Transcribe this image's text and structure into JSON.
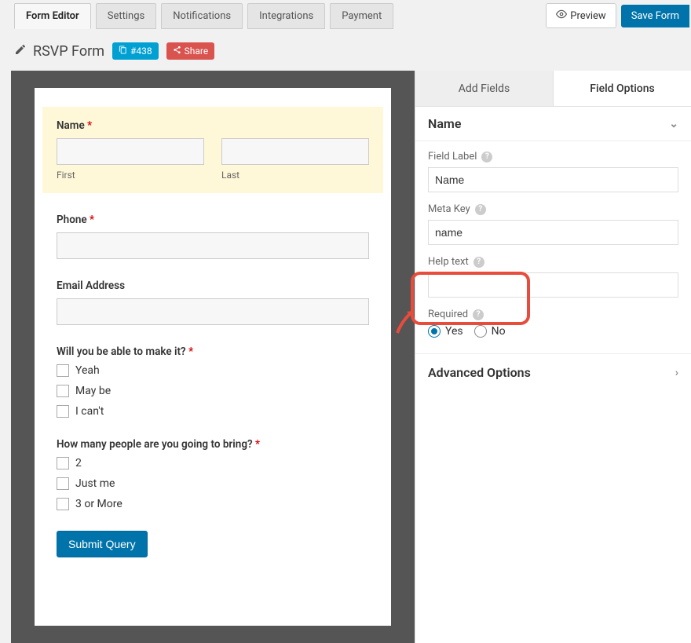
{
  "tabs": {
    "form_editor": "Form Editor",
    "settings": "Settings",
    "notifications": "Notifications",
    "integrations": "Integrations",
    "payment": "Payment"
  },
  "top_actions": {
    "preview": "Preview",
    "save": "Save Form"
  },
  "form_header": {
    "title": "RSVP Form",
    "id_badge": "#438",
    "share": "Share"
  },
  "form": {
    "name_label": "Name",
    "first_sub": "First",
    "last_sub": "Last",
    "phone_label": "Phone",
    "email_label": "Email Address",
    "attend_label": "Will you be able to make it?",
    "attend_opts": [
      "Yeah",
      "May be",
      "I can't"
    ],
    "count_label": "How many people are you going to bring?",
    "count_opts": [
      "2",
      "Just me",
      "3 or More"
    ],
    "submit": "Submit Query"
  },
  "side": {
    "add_fields": "Add Fields",
    "field_options": "Field Options",
    "section_name": "Name",
    "field_label_lbl": "Field Label",
    "field_label_val": "Name",
    "meta_key_lbl": "Meta Key",
    "meta_key_val": "name",
    "help_text_lbl": "Help text",
    "required_lbl": "Required",
    "required_yes": "Yes",
    "required_no": "No",
    "advanced": "Advanced Options"
  }
}
